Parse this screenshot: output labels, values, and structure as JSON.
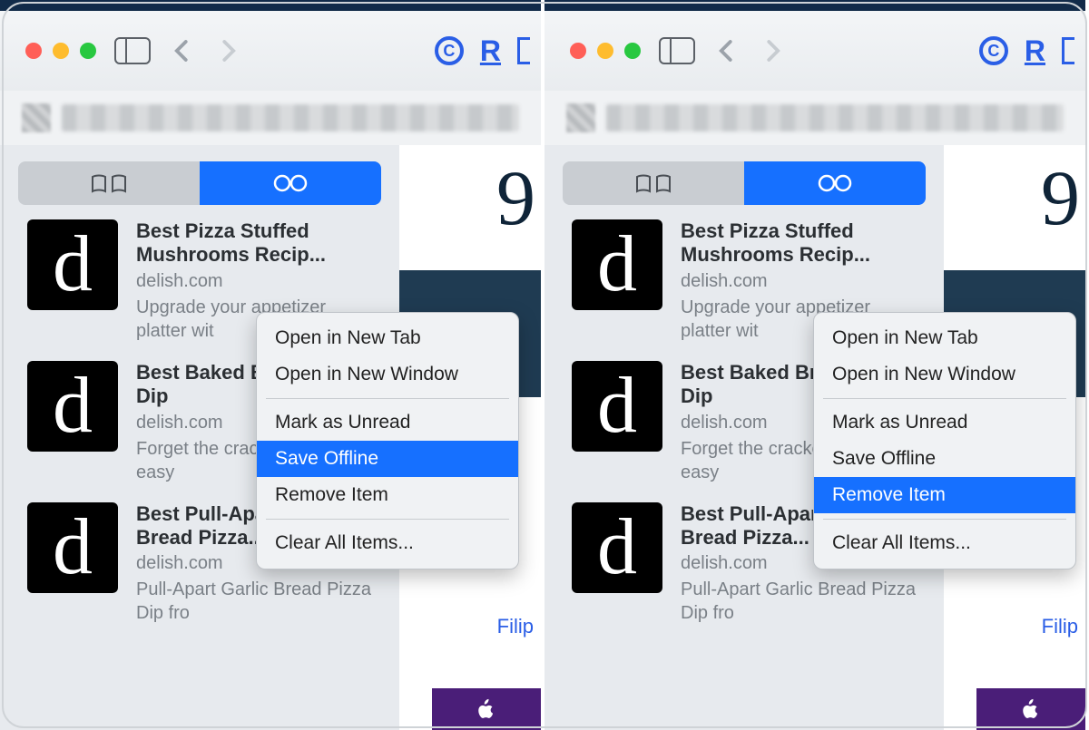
{
  "toolbar_icons": {
    "back": "‹",
    "forward": "›"
  },
  "segmented": {
    "bookmarks_icon": "book",
    "reading_list_icon": "glasses",
    "active": "reading_list"
  },
  "content_peek": {
    "big_number": "9",
    "link_text": "Filip"
  },
  "items": [
    {
      "favicon_letter": "d",
      "title": "Best Pizza Stuffed Mushrooms Recip...",
      "domain": "delish.com",
      "snippet": "Upgrade your appetizer platter wit"
    },
    {
      "favicon_letter": "d",
      "title": "Best Baked Brie Wreath Dip",
      "domain": "delish.com",
      "snippet": "Forget the crackers! In this easy"
    },
    {
      "favicon_letter": "d",
      "title": "Best Pull-Apart Garlic Bread Pizza...",
      "domain": "delish.com",
      "snippet": "Pull-Apart Garlic Bread Pizza Dip fro"
    }
  ],
  "menu": {
    "open_tab": "Open in New Tab",
    "open_window": "Open in New Window",
    "mark_unread": "Mark as Unread",
    "save_offline": "Save Offline",
    "remove_item": "Remove Item",
    "clear_all": "Clear All Items..."
  },
  "left_selected": "save_offline",
  "right_selected": "remove_item"
}
